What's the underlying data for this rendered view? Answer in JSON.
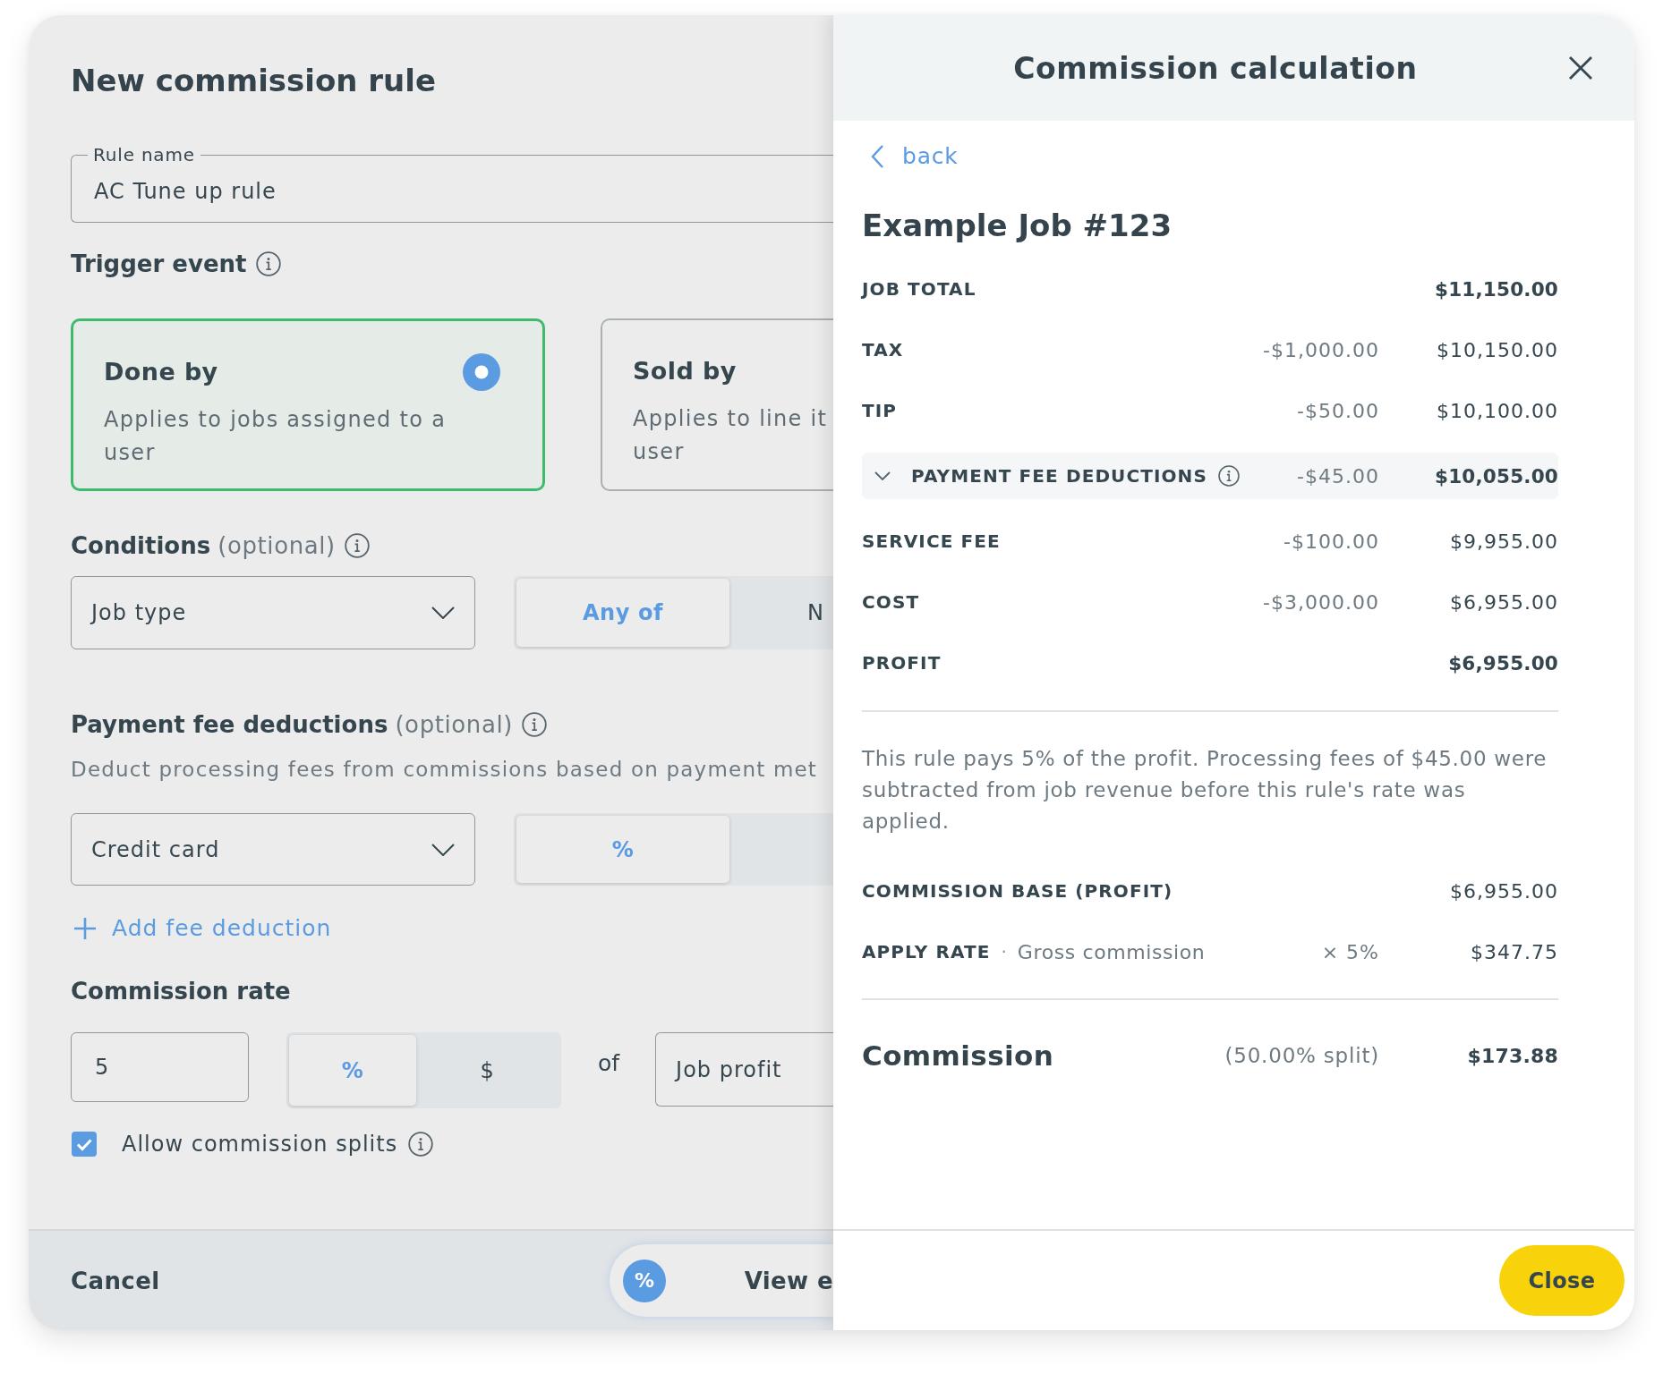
{
  "form": {
    "title": "New commission rule",
    "rule_name": {
      "label": "Rule name",
      "value": "AC Tune up rule"
    },
    "trigger_event": {
      "heading": "Trigger event",
      "options": [
        {
          "title": "Done by",
          "description_lines": [
            "Applies to jobs assigned to a",
            "user"
          ],
          "selected": true
        },
        {
          "title": "Sold by",
          "description_lines": [
            "Applies to line it",
            "user"
          ],
          "selected": false
        }
      ]
    },
    "conditions": {
      "heading": "Conditions",
      "note": "(optional)",
      "field": "Job type",
      "match_options": [
        {
          "label": "Any of",
          "selected": true
        },
        {
          "label": "N",
          "selected": false
        }
      ]
    },
    "payment_fee_deductions": {
      "heading": "Payment fee deductions",
      "note": "(optional)",
      "description": "Deduct processing fees from commissions based on payment met",
      "method": "Credit card",
      "unit_options": [
        {
          "label": "%",
          "selected": true
        }
      ],
      "add_link": "Add fee deduction"
    },
    "commission_rate": {
      "heading": "Commission rate",
      "value": "5",
      "unit_options": [
        {
          "label": "%",
          "selected": true
        },
        {
          "label": "$",
          "selected": false
        }
      ],
      "of_label": "of",
      "basis": "Job profit",
      "allow_splits": {
        "label": "Allow commission splits",
        "checked": true
      }
    },
    "footer": {
      "cancel": "Cancel",
      "view_button": {
        "badge": "%",
        "label": "View e"
      }
    }
  },
  "drawer": {
    "title": "Commission calculation",
    "back_link": "back",
    "job_title": "Example Job #123",
    "breakdown": [
      {
        "kind": "total",
        "label": "JOB TOTAL",
        "value": "$11,150.00"
      },
      {
        "kind": "step",
        "label": "TAX",
        "change": "-$1,000.00",
        "value": "$10,150.00"
      },
      {
        "kind": "step",
        "label": "TIP",
        "change": "-$50.00",
        "value": "$10,100.00"
      },
      {
        "kind": "group",
        "label": "PAYMENT FEE DEDUCTIONS",
        "change": "-$45.00",
        "value": "$10,055.00",
        "expanded": true
      },
      {
        "kind": "step",
        "label": "SERVICE FEE",
        "change": "-$100.00",
        "value": "$9,955.00"
      },
      {
        "kind": "step",
        "label": "COST",
        "change": "-$3,000.00",
        "value": "$6,955.00"
      },
      {
        "kind": "total",
        "label": "PROFIT",
        "value": "$6,955.00"
      }
    ],
    "explanation": "This rule pays 5% of the profit. Processing fees of $45.00 were subtracted from job revenue before this rule's rate was applied.",
    "calculation": [
      {
        "kind": "step",
        "label": "COMMISSION BASE (PROFIT)",
        "value": "$6,955.00"
      },
      {
        "kind": "step",
        "label": "APPLY RATE",
        "separator": "·",
        "note": "Gross commission",
        "change": "× 5%",
        "value": "$347.75"
      }
    ],
    "commission": {
      "label": "Commission",
      "split": "(50.00% split)",
      "value": "$173.88"
    },
    "close_button": "Close"
  }
}
